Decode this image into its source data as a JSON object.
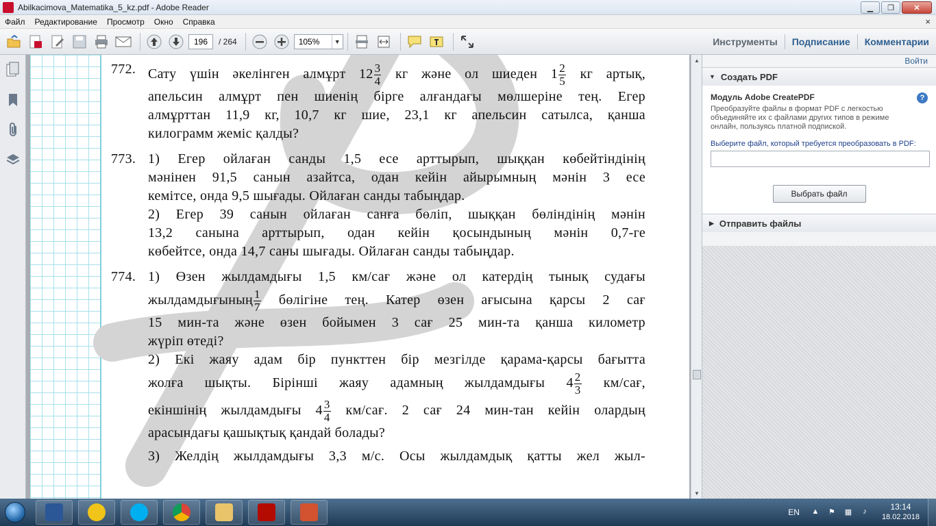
{
  "window": {
    "title": "Abilkacimova_Matematika_5_kz.pdf - Adobe Reader"
  },
  "menu": {
    "items": [
      "Файл",
      "Редактирование",
      "Просмотр",
      "Окно",
      "Справка"
    ],
    "close": "×"
  },
  "toolbar": {
    "current_page": "196",
    "total_pages": "/ 264",
    "zoom": "105%",
    "links": {
      "tools": "Инструменты",
      "sign": "Подписание",
      "comments": "Комментарии"
    }
  },
  "document": {
    "p772": {
      "num": "772.",
      "l1a": "Сату үшін әкелінген алмұрт 12",
      "f1n": "3",
      "f1d": "4",
      "l1b": "кг және ол шиеден 1",
      "f2n": "2",
      "f2d": "5",
      "l1c": "кг артық,",
      "l2": "апельсин алмұрт пен шиенің бірге алғандағы мөлшеріне тең. Егер",
      "l3": "алмұрттан 11,9 кг, 10,7 кг шие, 23,1 кг апельсин сатылса, қанша",
      "l4": "килограмм жеміс қалды?"
    },
    "p773": {
      "num": "773.",
      "l1": "1) Егер ойлаған санды 1,5 есе арттырып, шыққан көбейтіндінің",
      "l2": "мәнінен 91,5 санын азайтса, одан кейін айырымның мәнін 3 есе",
      "l3": "кемітсе, онда 9,5 шығады. Ойлаған санды табыңдар.",
      "l4": "2) Егер 39 санын ойлаған санға бөліп, шыққан бөліндінің мәнін",
      "l5": "13,2 санына арттырып, одан кейін қосындының мәнін 0,7-ге",
      "l6": "көбейтсе, онда 14,7 саны шығады. Ойлаған санды табыңдар."
    },
    "p774": {
      "num": "774.",
      "l1": "1) Өзен жылдамдығы 1,5 км/сағ және ол катердің тынық судағы",
      "l2a": "жылдамдығының",
      "f1n": "1",
      "f1d": "7",
      "l2b": "бөлігіне тең. Катер өзен ағысына қарсы 2 сағ",
      "l3": "15 мин-та және өзен бойымен 3 сағ 25 мин-та қанша километр",
      "l4": "жүріп өтеді?",
      "l5": "2) Екі жаяу адам бір пункттен бір мезгілде қарама-қарсы бағытта",
      "l6a": "жолға шықты. Бірінші жаяу адамның жылдамдығы 4",
      "f2n": "2",
      "f2d": "3",
      "l6b": "км/сағ,",
      "l7a": "екіншінің жылдамдығы 4",
      "f3n": "3",
      "f3d": "4",
      "l7b": "км/сағ. 2 сағ 24 мин-тан кейін олардың",
      "l8": "арасындағы қашықтық қандай болады?",
      "l9": "3) Желдің жылдамдығы 3,3 м/с. Осы жылдамдық қатты жел жыл-"
    }
  },
  "right_panel": {
    "login": "Войти",
    "create_pdf": {
      "header": "Создать PDF",
      "module_title": "Модуль Adobe CreatePDF",
      "description": "Преобразуйте файлы в формат PDF с легкостью объединяйте их с файлами других типов в режиме онлайн, пользуясь платной подпиской.",
      "choose_label": "Выберите файл, который требуется преобразовать в PDF:",
      "choose_button": "Выбрать файл",
      "help": "?"
    },
    "send_files": {
      "header": "Отправить файлы"
    }
  },
  "taskbar": {
    "lang": "EN",
    "time": "13:14",
    "date": "18.02.2018",
    "apps": [
      "word",
      "email",
      "skype",
      "chrome",
      "explorer",
      "acrobat",
      "presentation"
    ]
  },
  "colors": {
    "accent": "#2f5f8f",
    "grid": "#a6e1ea",
    "watermark": "#d0d0d0"
  }
}
